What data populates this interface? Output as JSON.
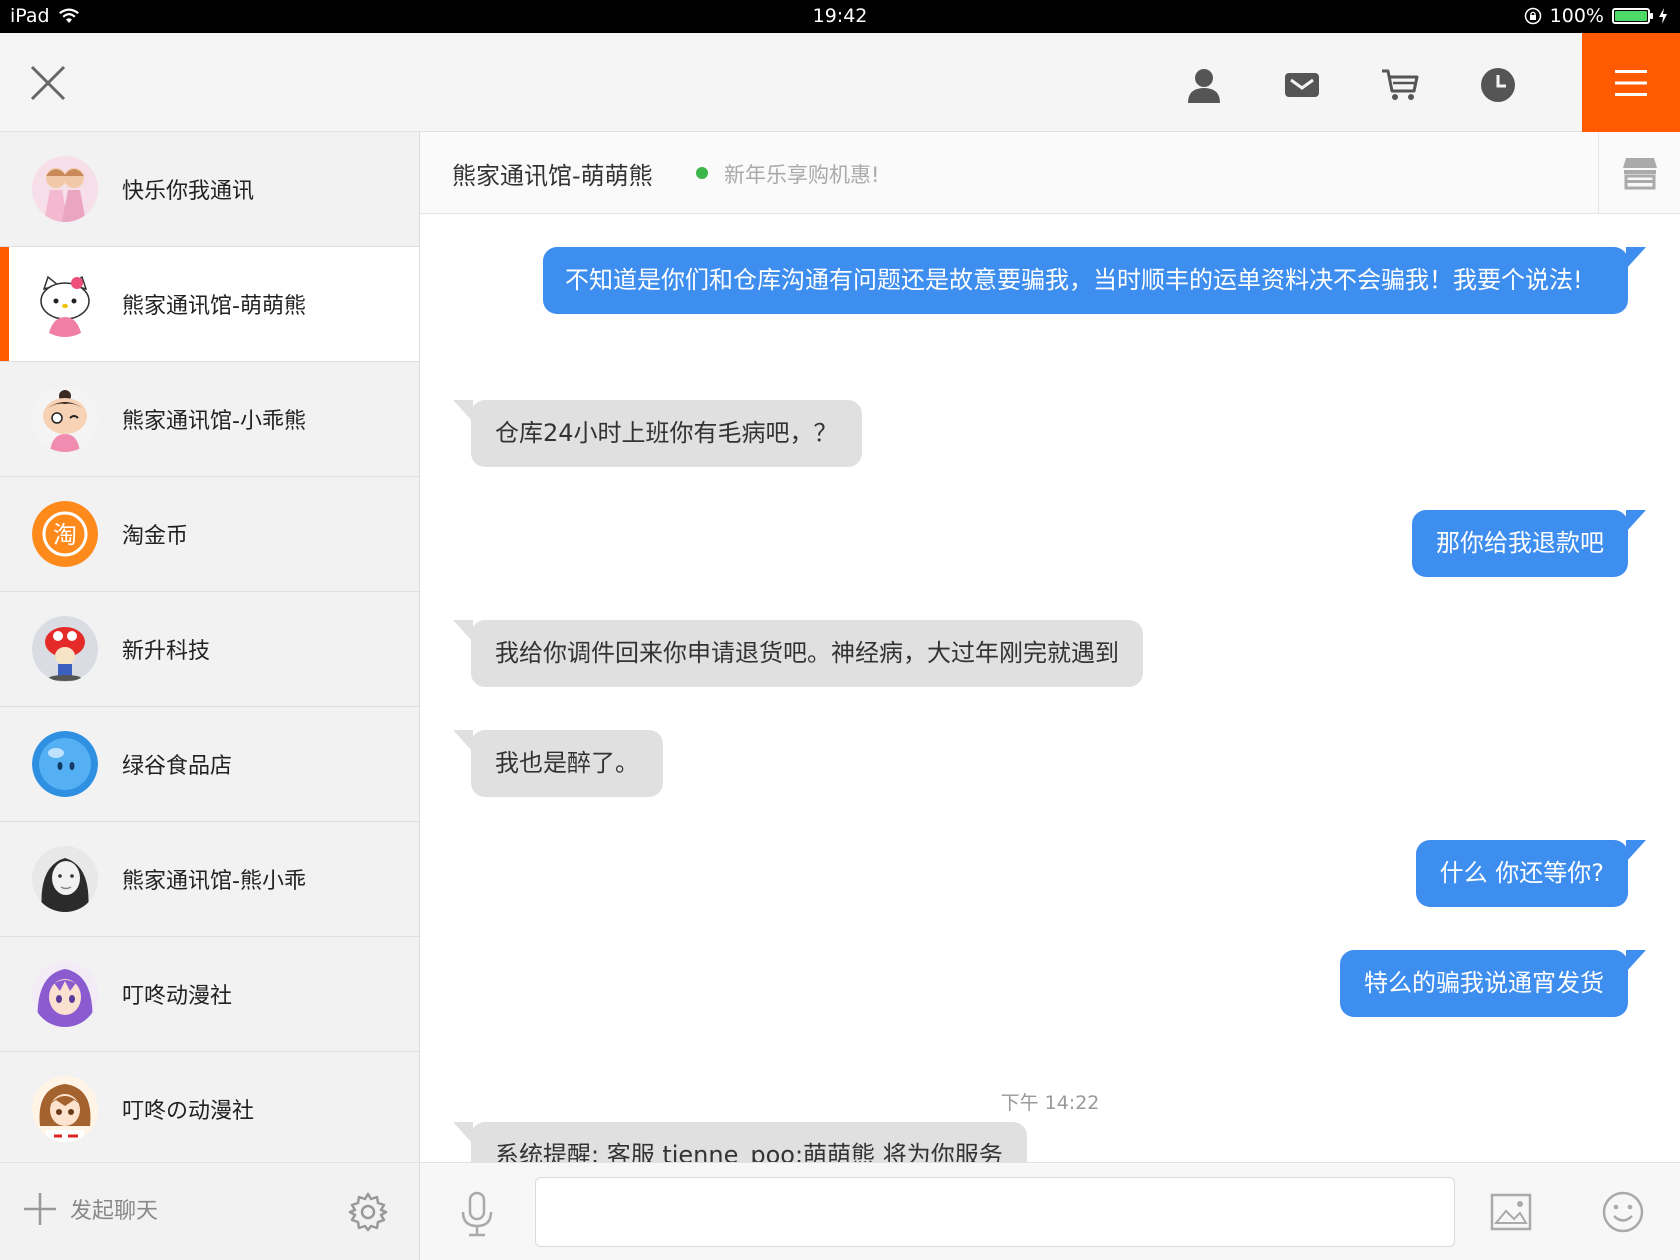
{
  "status_bar": {
    "device": "iPad",
    "time": "19:42",
    "battery": "100%",
    "battery_level": 1.0
  },
  "topbar": {
    "icons": [
      "close-icon",
      "user-icon",
      "mail-icon",
      "cart-icon",
      "clock-icon",
      "menu-icon"
    ]
  },
  "sidebar": {
    "contacts": [
      {
        "name": "快乐你我通讯"
      },
      {
        "name": "熊家通讯馆-萌萌熊"
      },
      {
        "name": "熊家通讯馆-小乖熊"
      },
      {
        "name": "淘金币"
      },
      {
        "name": "新升科技"
      },
      {
        "name": "绿谷食品店"
      },
      {
        "name": "熊家通讯馆-熊小乖"
      },
      {
        "name": "叮咚动漫社"
      },
      {
        "name": "叮咚の动漫社"
      }
    ],
    "taojinbi_glyph": "淘",
    "new_chat_label": "发起聊天"
  },
  "chat": {
    "title": "熊家通讯馆-萌萌熊",
    "subtitle": "新年乐享购机惠!",
    "messages": [
      {
        "dir": "out",
        "text": "不知道是你们和仓库沟通有问题还是故意要骗我，当时顺丰的运单资料决不会骗我！我要个说法!"
      },
      {
        "dir": "in",
        "text": "仓库24小时上班你有毛病吧，？"
      },
      {
        "dir": "out",
        "text": "那你给我退款吧"
      },
      {
        "dir": "in",
        "text": "我给你调件回来你申请退货吧。神经病，大过年刚完就遇到"
      },
      {
        "dir": "in",
        "text": "我也是醉了。"
      },
      {
        "dir": "out",
        "text": "什么 你还等你?"
      },
      {
        "dir": "out",
        "text": "特么的骗我说通宵发货"
      },
      {
        "dir": "in",
        "text": "系统提醒: 客服 tienne_poo:萌萌熊 将为你服务"
      }
    ],
    "timestamp": "下午 14:22"
  },
  "colors": {
    "accent": "#ff5a00",
    "bubble_out": "#3e8ef0",
    "bubble_in": "#e0e0e0",
    "online": "#3cb54a"
  }
}
